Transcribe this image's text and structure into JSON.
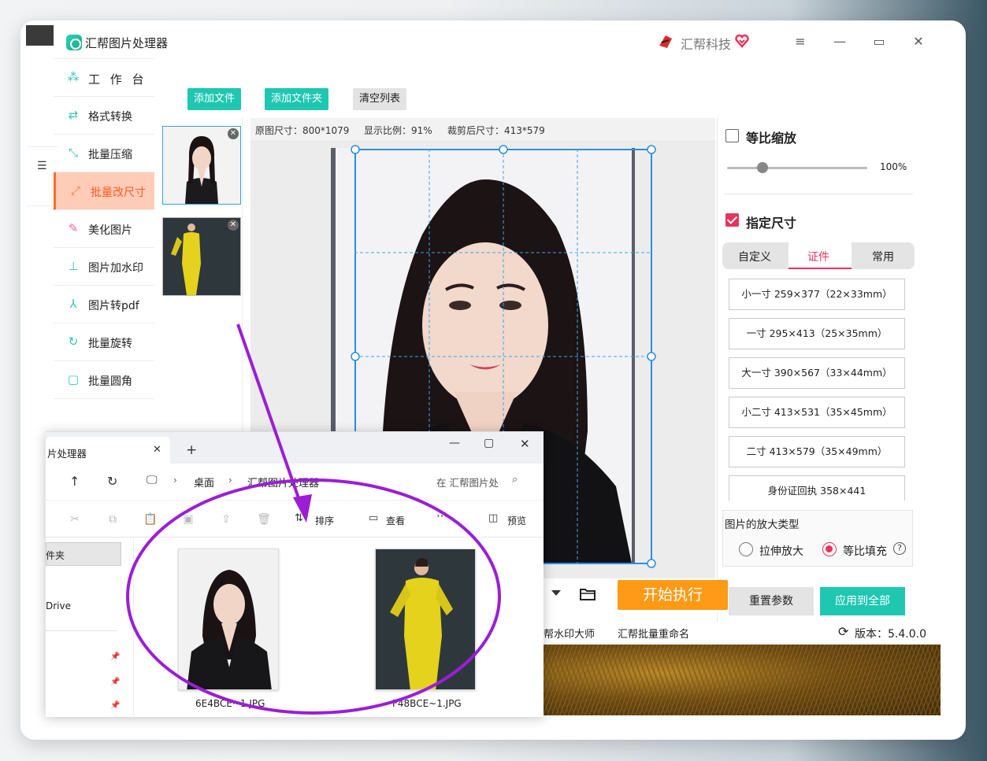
{
  "app": {
    "title": "汇帮图片处理器",
    "brand": "汇帮科技",
    "window_controls": [
      "menu-icon",
      "minimize-icon",
      "maximize-icon",
      "close-icon"
    ]
  },
  "sidebar": {
    "items": [
      {
        "label": "工 作 台",
        "icon": "grid-icon"
      },
      {
        "label": "格式转换",
        "icon": "convert-icon"
      },
      {
        "label": "批量压缩",
        "icon": "compress-icon"
      },
      {
        "label": "批量改尺寸",
        "icon": "resize-icon",
        "active": true
      },
      {
        "label": "美化图片",
        "icon": "beautify-icon"
      },
      {
        "label": "图片加水印",
        "icon": "watermark-icon"
      },
      {
        "label": "图片转pdf",
        "icon": "pdf-icon"
      },
      {
        "label": "批量旋转",
        "icon": "rotate-icon"
      },
      {
        "label": "批量圆角",
        "icon": "round-corner-icon"
      }
    ]
  },
  "toolbar": {
    "add_file": "添加文件",
    "add_folder": "添加文件夹",
    "clear_list": "清空列表"
  },
  "info_bar": {
    "original_size": "原图尺寸：800*1079",
    "display_ratio": "显示比例：91%",
    "cropped_size": "裁剪后尺寸：413*579"
  },
  "right_panel": {
    "proportional_scale": "等比缩放",
    "zoom_value": "100%",
    "zoom_fraction": 0.24,
    "specified_size": "指定尺寸",
    "tabs": [
      "自定义",
      "证件",
      "常用"
    ],
    "active_tab": "证件",
    "sizes": [
      "小一寸 259×377（22×33mm）",
      "一寸 295×413（25×35mm）",
      "大一寸 390×567（33×44mm）",
      "小二寸 413×531（35×45mm）",
      "二寸 413×579（35×49mm）",
      "身份证回执 358×441"
    ],
    "zoom_type_title": "图片的放大类型",
    "stretch": "拉伸放大",
    "proportional_fill": "等比填充",
    "reset": "重置参数",
    "apply_all": "应用到全部"
  },
  "execute": "开始执行",
  "bottom_links": [
    "帮水印大师",
    "汇帮批量重命名"
  ],
  "version": "版本：5.4.0.0",
  "explorer": {
    "tab_title": "片处理器",
    "path": [
      "桌面",
      "汇帮图片处理器"
    ],
    "search_placeholder": "在 汇帮图片处",
    "sort": "排序",
    "view": "查看",
    "preview": "预览",
    "nav_items": [
      "件夹",
      "Drive"
    ],
    "files": [
      "6E4BCE~1.JPG",
      "F48BCE~1.JPG"
    ]
  },
  "colors": {
    "accent_teal": "#1fc7b1",
    "active_orange": "#ff5a1f",
    "execute_orange": "#ff9a16",
    "pink": "#e8345a",
    "annotation_purple": "#9b1ed6"
  }
}
